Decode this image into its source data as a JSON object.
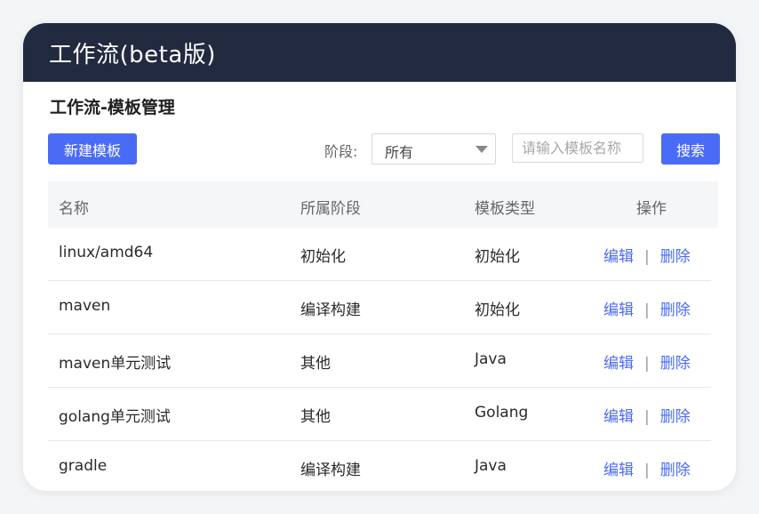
{
  "window": {
    "title": "工作流(beta版)"
  },
  "page": {
    "title": "工作流-模板管理"
  },
  "toolbar": {
    "new_label": "新建模板",
    "stage_label": "阶段:",
    "stage_value": "所有",
    "search_placeholder": "请输入模板名称",
    "search_label": "搜索"
  },
  "table": {
    "headers": [
      "名称",
      "所属阶段",
      "模板类型",
      "操作"
    ],
    "rows": [
      {
        "name": "linux/amd64",
        "stage": "初始化",
        "type": "初始化",
        "edit": "编辑",
        "delete": "删除"
      },
      {
        "name": "maven",
        "stage": "编译构建",
        "type": "初始化",
        "edit": "编辑",
        "delete": "删除"
      },
      {
        "name": "maven单元测试",
        "stage": "其他",
        "type": "Java",
        "edit": "编辑",
        "delete": "删除"
      },
      {
        "name": "golang单元测试",
        "stage": "其他",
        "type": "Golang",
        "edit": "编辑",
        "delete": "删除"
      },
      {
        "name": "gradle",
        "stage": "编译构建",
        "type": "Java",
        "edit": "编辑",
        "delete": "删除"
      }
    ],
    "separator": "|"
  },
  "colors": {
    "header_bg": "#222a3f",
    "accent": "#4a6bf5"
  }
}
